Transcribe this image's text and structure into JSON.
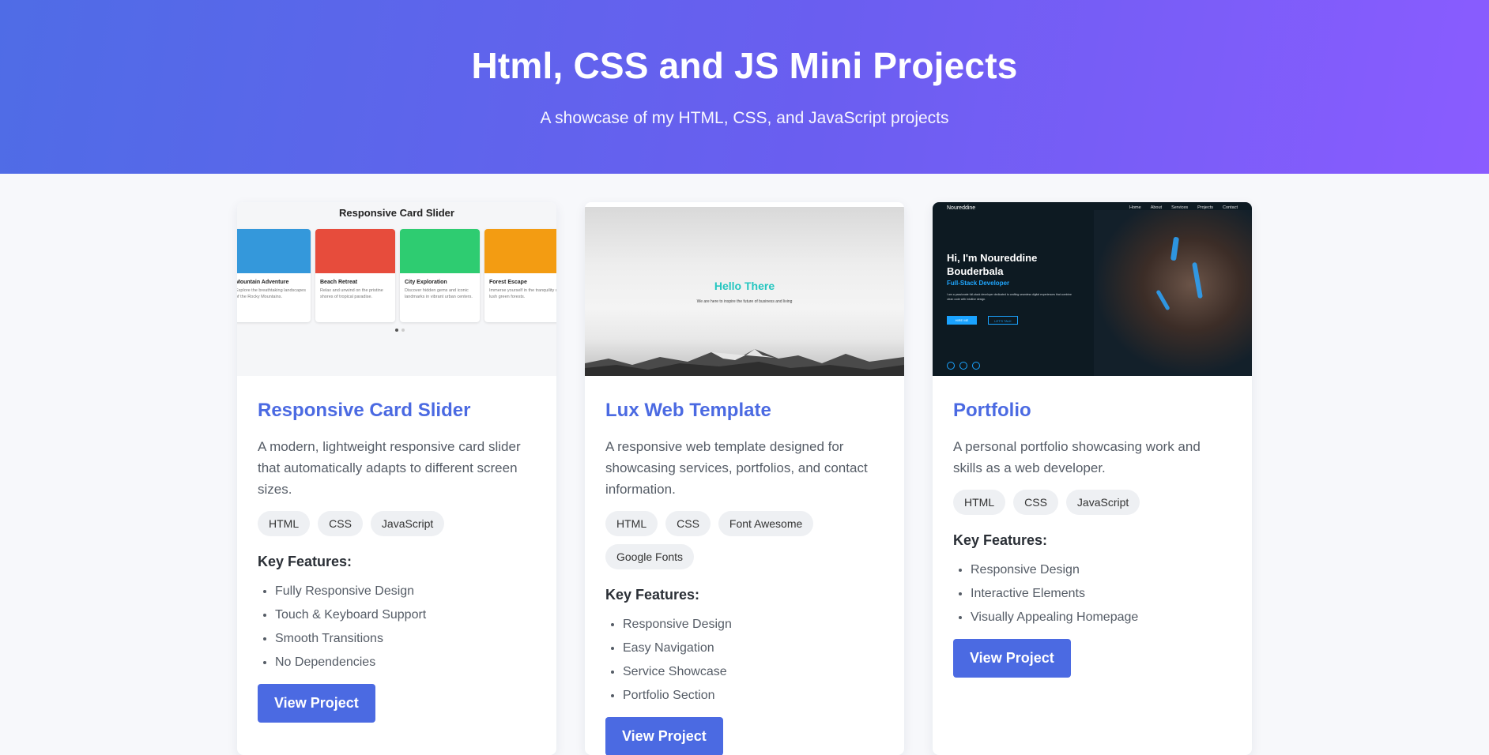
{
  "header": {
    "title": "Html, CSS and JS Mini Projects",
    "subtitle": "A showcase of my HTML, CSS, and JavaScript projects"
  },
  "colors": {
    "accent": "#4b6ae2",
    "gradient_start": "#4f6ce6",
    "gradient_end": "#8a5cff"
  },
  "projects": [
    {
      "title": "Responsive Card Slider",
      "description": "A modern, lightweight responsive card slider that automatically adapts to different screen sizes.",
      "tags": [
        "HTML",
        "CSS",
        "JavaScript"
      ],
      "features_title": "Key Features:",
      "features": [
        "Fully Responsive Design",
        "Touch & Keyboard Support",
        "Smooth Transitions",
        "No Dependencies"
      ],
      "button": "View Project",
      "preview": {
        "title": "Responsive Card Slider",
        "cards": [
          {
            "title": "Mountain Adventure",
            "text": "Explore the breathtaking landscapes of the Rocky Mountains.",
            "color": "#3498db"
          },
          {
            "title": "Beach Retreat",
            "text": "Relax and unwind on the pristine shores of tropical paradise.",
            "color": "#e74c3c"
          },
          {
            "title": "City Exploration",
            "text": "Discover hidden gems and iconic landmarks in vibrant urban centers.",
            "color": "#2ecc71"
          },
          {
            "title": "Forest Escape",
            "text": "Immerse yourself in the tranquility of lush green forests.",
            "color": "#f39c12"
          }
        ]
      }
    },
    {
      "title": "Lux Web Template",
      "description": "A responsive web template designed for showcasing services, portfolios, and contact information.",
      "tags": [
        "HTML",
        "CSS",
        "Font Awesome",
        "Google Fonts"
      ],
      "features_title": "Key Features:",
      "features": [
        "Responsive Design",
        "Easy Navigation",
        "Service Showcase",
        "Portfolio Section"
      ],
      "button": "View Project",
      "preview": {
        "heading": "Hello There",
        "text": "We are here to inspire the future of business and living"
      }
    },
    {
      "title": "Portfolio",
      "description": "A personal portfolio showcasing work and skills as a web developer.",
      "tags": [
        "HTML",
        "CSS",
        "JavaScript"
      ],
      "features_title": "Key Features:",
      "features": [
        "Responsive Design",
        "Interactive Elements",
        "Visually Appealing Homepage"
      ],
      "button": "View Project",
      "preview": {
        "brand": "Noureddine",
        "nav": [
          "Home",
          "About",
          "Services",
          "Projects",
          "Contact"
        ],
        "greeting": "Hi, I'm Noureddine Bouderbala",
        "role": "Full-Stack Developer",
        "text": "I am a passionate full-stack developer dedicated to crafting seamless digital experiences that combine clean code with intuitive design.",
        "btn_primary": "HIRE ME",
        "btn_secondary": "LET'S TALK"
      }
    }
  ]
}
